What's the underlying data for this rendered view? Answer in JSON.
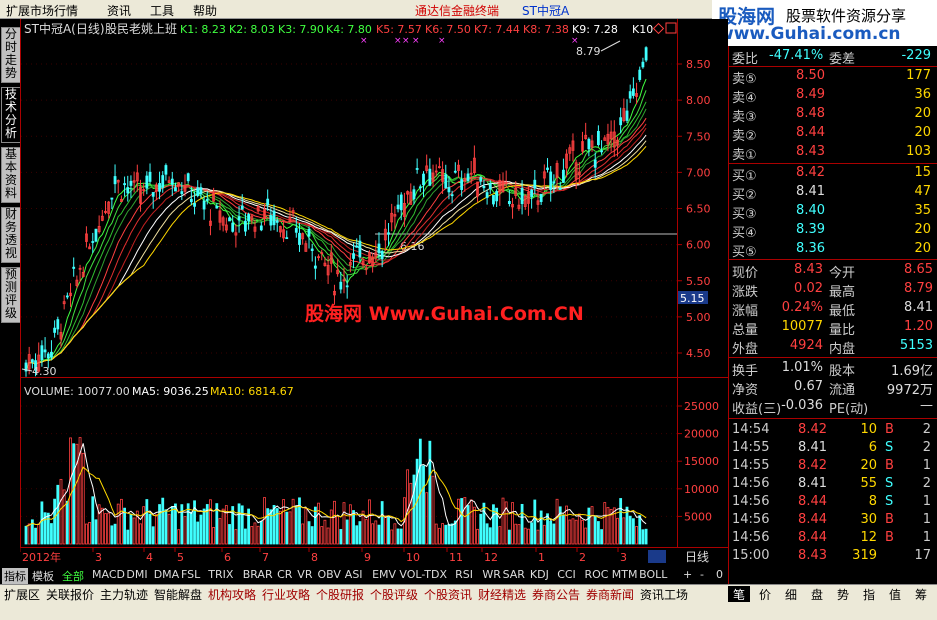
{
  "menu": [
    "扩展市场行情",
    "资讯",
    "工具",
    "帮助"
  ],
  "app_title": "通达信金融终端",
  "app_stock": "ST中冠A",
  "brand": {
    "name": "股海网",
    "slogan": "股票软件资源分享",
    "url": "www.Guhai.com.cn"
  },
  "left_tabs": [
    "分时走势",
    "技术分析",
    "基本资料",
    "财务透视",
    "预测评级"
  ],
  "chart": {
    "header_name": "ST中冠A(日线)",
    "header_note": "股民老姚上班",
    "k_lines": [
      {
        "label": "K1: 8.23",
        "color": "#40ff40"
      },
      {
        "label": "K2: 8.03",
        "color": "#40ff40"
      },
      {
        "label": "K3: 7.90",
        "color": "#40ff40"
      },
      {
        "label": "K4: 7.80",
        "color": "#40ff40"
      },
      {
        "label": "K5: 7.57",
        "color": "#ff4040"
      },
      {
        "label": "K6: 7.50",
        "color": "#ff4040"
      },
      {
        "label": "K7: 7.44",
        "color": "#ff4040"
      },
      {
        "label": "K8: 7.38",
        "color": "#ff4040"
      },
      {
        "label": "K9: 7.28",
        "color": "#ffffff"
      },
      {
        "label": "K10",
        "color": "#ffffff"
      }
    ],
    "price_axis": [
      "8.50",
      "8.00",
      "7.50",
      "7.00",
      "6.50",
      "6.00",
      "5.50",
      "5.15",
      "5.00",
      "4.50"
    ],
    "high_label": "8.79",
    "low_label": "4.30",
    "mid_label": "6.16",
    "volume_header": "VOLUME: 10077.00",
    "ma5_label": "MA5: 9036.25",
    "ma10_label": "MA10: 6814.67",
    "volume_axis": [
      "25000",
      "20000",
      "15000",
      "10000",
      "5000"
    ],
    "x_labels": [
      "2012年",
      "3",
      "4",
      "5",
      "6",
      "7",
      "8",
      "9",
      "10",
      "11",
      "12",
      "1",
      "2",
      "3"
    ],
    "period": "日线",
    "watermark": "股海网 Www.Guhai.Com.CN"
  },
  "panel": {
    "weibi_label": "委比",
    "weibi_value": "-47.41%",
    "weicha_label": "委差",
    "weicha_value": "-229",
    "sells": [
      {
        "label": "卖⑤",
        "price": "8.50",
        "vol": "177",
        "color": "#ff4040"
      },
      {
        "label": "卖④",
        "price": "8.49",
        "vol": "36",
        "color": "#ff4040"
      },
      {
        "label": "卖③",
        "price": "8.48",
        "vol": "20",
        "color": "#ff4040"
      },
      {
        "label": "卖②",
        "price": "8.44",
        "vol": "20",
        "color": "#ff4040"
      },
      {
        "label": "卖①",
        "price": "8.43",
        "vol": "103",
        "color": "#ff4040"
      }
    ],
    "buys": [
      {
        "label": "买①",
        "price": "8.42",
        "vol": "15",
        "color": "#ff4040"
      },
      {
        "label": "买②",
        "price": "8.41",
        "vol": "47",
        "color": "#dddddd"
      },
      {
        "label": "买③",
        "price": "8.40",
        "vol": "35",
        "color": "#40ffff"
      },
      {
        "label": "买④",
        "price": "8.39",
        "vol": "20",
        "color": "#40ffff"
      },
      {
        "label": "买⑤",
        "price": "8.36",
        "vol": "20",
        "color": "#40ffff"
      }
    ],
    "quotes": [
      {
        "l1": "现价",
        "v1": "8.43",
        "c1": "#ff4040",
        "l2": "今开",
        "v2": "8.65",
        "c2": "#ff4040"
      },
      {
        "l1": "涨跌",
        "v1": "0.02",
        "c1": "#ff4040",
        "l2": "最高",
        "v2": "8.79",
        "c2": "#ff4040"
      },
      {
        "l1": "涨幅",
        "v1": "0.24%",
        "c1": "#ff4040",
        "l2": "最低",
        "v2": "8.41",
        "c2": "#dddddd"
      },
      {
        "l1": "总量",
        "v1": "10077",
        "c1": "#ffd800",
        "l2": "量比",
        "v2": "1.20",
        "c2": "#ff4040"
      },
      {
        "l1": "外盘",
        "v1": "4924",
        "c1": "#ff4040",
        "l2": "内盘",
        "v2": "5153",
        "c2": "#40ffff"
      }
    ],
    "stats": [
      {
        "l1": "换手",
        "v1": "1.01%",
        "l2": "股本",
        "v2": "1.69亿"
      },
      {
        "l1": "净资",
        "v1": "0.67",
        "l2": "流通",
        "v2": "9972万"
      },
      {
        "l1": "收益(三)",
        "v1": "-0.036",
        "l2": "PE(动)",
        "v2": "—"
      }
    ],
    "trades": [
      {
        "time": "14:54",
        "price": "8.42",
        "vol": "10",
        "bs": "B",
        "n": "2",
        "pc": "#ff4040",
        "bc": "#ff4040"
      },
      {
        "time": "14:55",
        "price": "8.41",
        "vol": "6",
        "bs": "S",
        "n": "2",
        "pc": "#dddddd",
        "bc": "#40ffff"
      },
      {
        "time": "14:55",
        "price": "8.42",
        "vol": "20",
        "bs": "B",
        "n": "1",
        "pc": "#ff4040",
        "bc": "#ff4040"
      },
      {
        "time": "14:56",
        "price": "8.41",
        "vol": "55",
        "bs": "S",
        "n": "2",
        "pc": "#dddddd",
        "bc": "#40ffff"
      },
      {
        "time": "14:56",
        "price": "8.44",
        "vol": "8",
        "bs": "S",
        "n": "1",
        "pc": "#ff4040",
        "bc": "#40ffff"
      },
      {
        "time": "14:56",
        "price": "8.44",
        "vol": "30",
        "bs": "B",
        "n": "1",
        "pc": "#ff4040",
        "bc": "#ff4040"
      },
      {
        "time": "14:56",
        "price": "8.44",
        "vol": "12",
        "bs": "B",
        "n": "1",
        "pc": "#ff4040",
        "bc": "#ff4040"
      },
      {
        "time": "15:00",
        "price": "8.43",
        "vol": "319",
        "bs": "",
        "n": "17",
        "pc": "#ff4040",
        "bc": "#ff4040"
      }
    ]
  },
  "indicators": [
    "指标",
    "模板",
    "全部",
    "MACD",
    "DMI",
    "DMA",
    "FSL",
    "TRIX",
    "BRAR",
    "CR",
    "VR",
    "OBV",
    "ASI",
    "EMV",
    "VOL-TDX",
    "RSI",
    "WR",
    "SAR",
    "KDJ",
    "CCI",
    "ROC",
    "MTM",
    "BOLL"
  ],
  "ind_controls": [
    "+",
    "-",
    "0"
  ],
  "bottom_tabs": [
    "扩展区",
    "关联报价",
    "主力轨迹",
    "智能解盘",
    "机构攻略",
    "行业攻略",
    "个股研报",
    "个股评级",
    "个股资讯",
    "财经精选",
    "券商公告",
    "券商新闻",
    "资讯工场"
  ],
  "right_tabs": [
    "笔",
    "价",
    "细",
    "盘",
    "势",
    "指",
    "值",
    "筹"
  ],
  "colors": {
    "up": "#ff4040",
    "down": "#40ffff",
    "axis_red": "#aa0000",
    "ma_yellow": "#ffd800"
  }
}
